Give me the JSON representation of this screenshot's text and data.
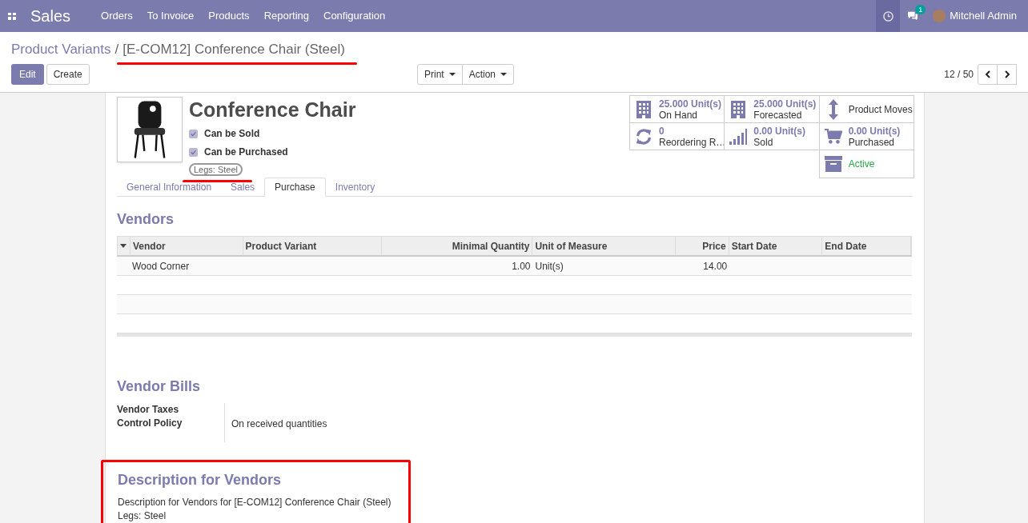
{
  "navbar": {
    "app_name": "Sales",
    "menu": [
      "Orders",
      "To Invoice",
      "Products",
      "Reporting",
      "Configuration"
    ],
    "notification_count": "1",
    "user": "Mitchell Admin"
  },
  "breadcrumb": {
    "parent": "Product Variants",
    "separator": "/",
    "current": "[E-COM12] Conference Chair (Steel)"
  },
  "control_panel": {
    "buttons": [
      {
        "label": "Edit",
        "kind": "primary"
      },
      {
        "label": "Create",
        "kind": "secondary"
      }
    ],
    "dropdowns": [
      "Print",
      "Action"
    ],
    "pager": "12 / 50"
  },
  "product": {
    "name": "Conference Chair",
    "checkboxes": [
      {
        "label": "Can be Sold",
        "checked": true
      },
      {
        "label": "Can be Purchased",
        "checked": true
      }
    ],
    "attribute_tag": "Legs: Steel"
  },
  "smart_buttons": [
    {
      "kind": "stat",
      "value": "25.000 Unit(s)",
      "label": "On Hand"
    },
    {
      "kind": "stat",
      "value": "25.000 Unit(s)",
      "label": "Forecasted"
    },
    {
      "kind": "link",
      "label": "Product Moves"
    },
    {
      "kind": "stat",
      "value": "0",
      "label": "Reordering R…"
    },
    {
      "kind": "stat",
      "value": "0.00 Unit(s)",
      "label": "Sold"
    },
    {
      "kind": "stat",
      "value": "0.00 Unit(s)",
      "label": "Purchased"
    },
    {
      "kind": "toggle",
      "label": "Active",
      "on": true
    }
  ],
  "tabs": [
    {
      "label": "General Information",
      "selected": false
    },
    {
      "label": "Sales",
      "selected": false
    },
    {
      "label": "Purchase",
      "selected": true
    },
    {
      "label": "Inventory",
      "selected": false
    }
  ],
  "vendors": {
    "title": "Vendors",
    "columns": [
      "Vendor",
      "Product Variant",
      "Minimal Quantity",
      "Unit of Measure",
      "Price",
      "Start Date",
      "End Date"
    ],
    "rows": [
      {
        "cells": [
          "Wood Corner",
          "",
          "1.00",
          "Unit(s)",
          "14.00",
          "",
          ""
        ]
      }
    ]
  },
  "vendor_bills": {
    "title": "Vendor Bills",
    "fields": [
      {
        "label": "Vendor Taxes"
      },
      {
        "label": "Control Policy",
        "value": "On received quantities"
      }
    ]
  },
  "description": {
    "title": "Description for Vendors",
    "lines": [
      "Description for Vendors for [E-COM12] Conference Chair (Steel)",
      "Legs: Steel"
    ]
  }
}
